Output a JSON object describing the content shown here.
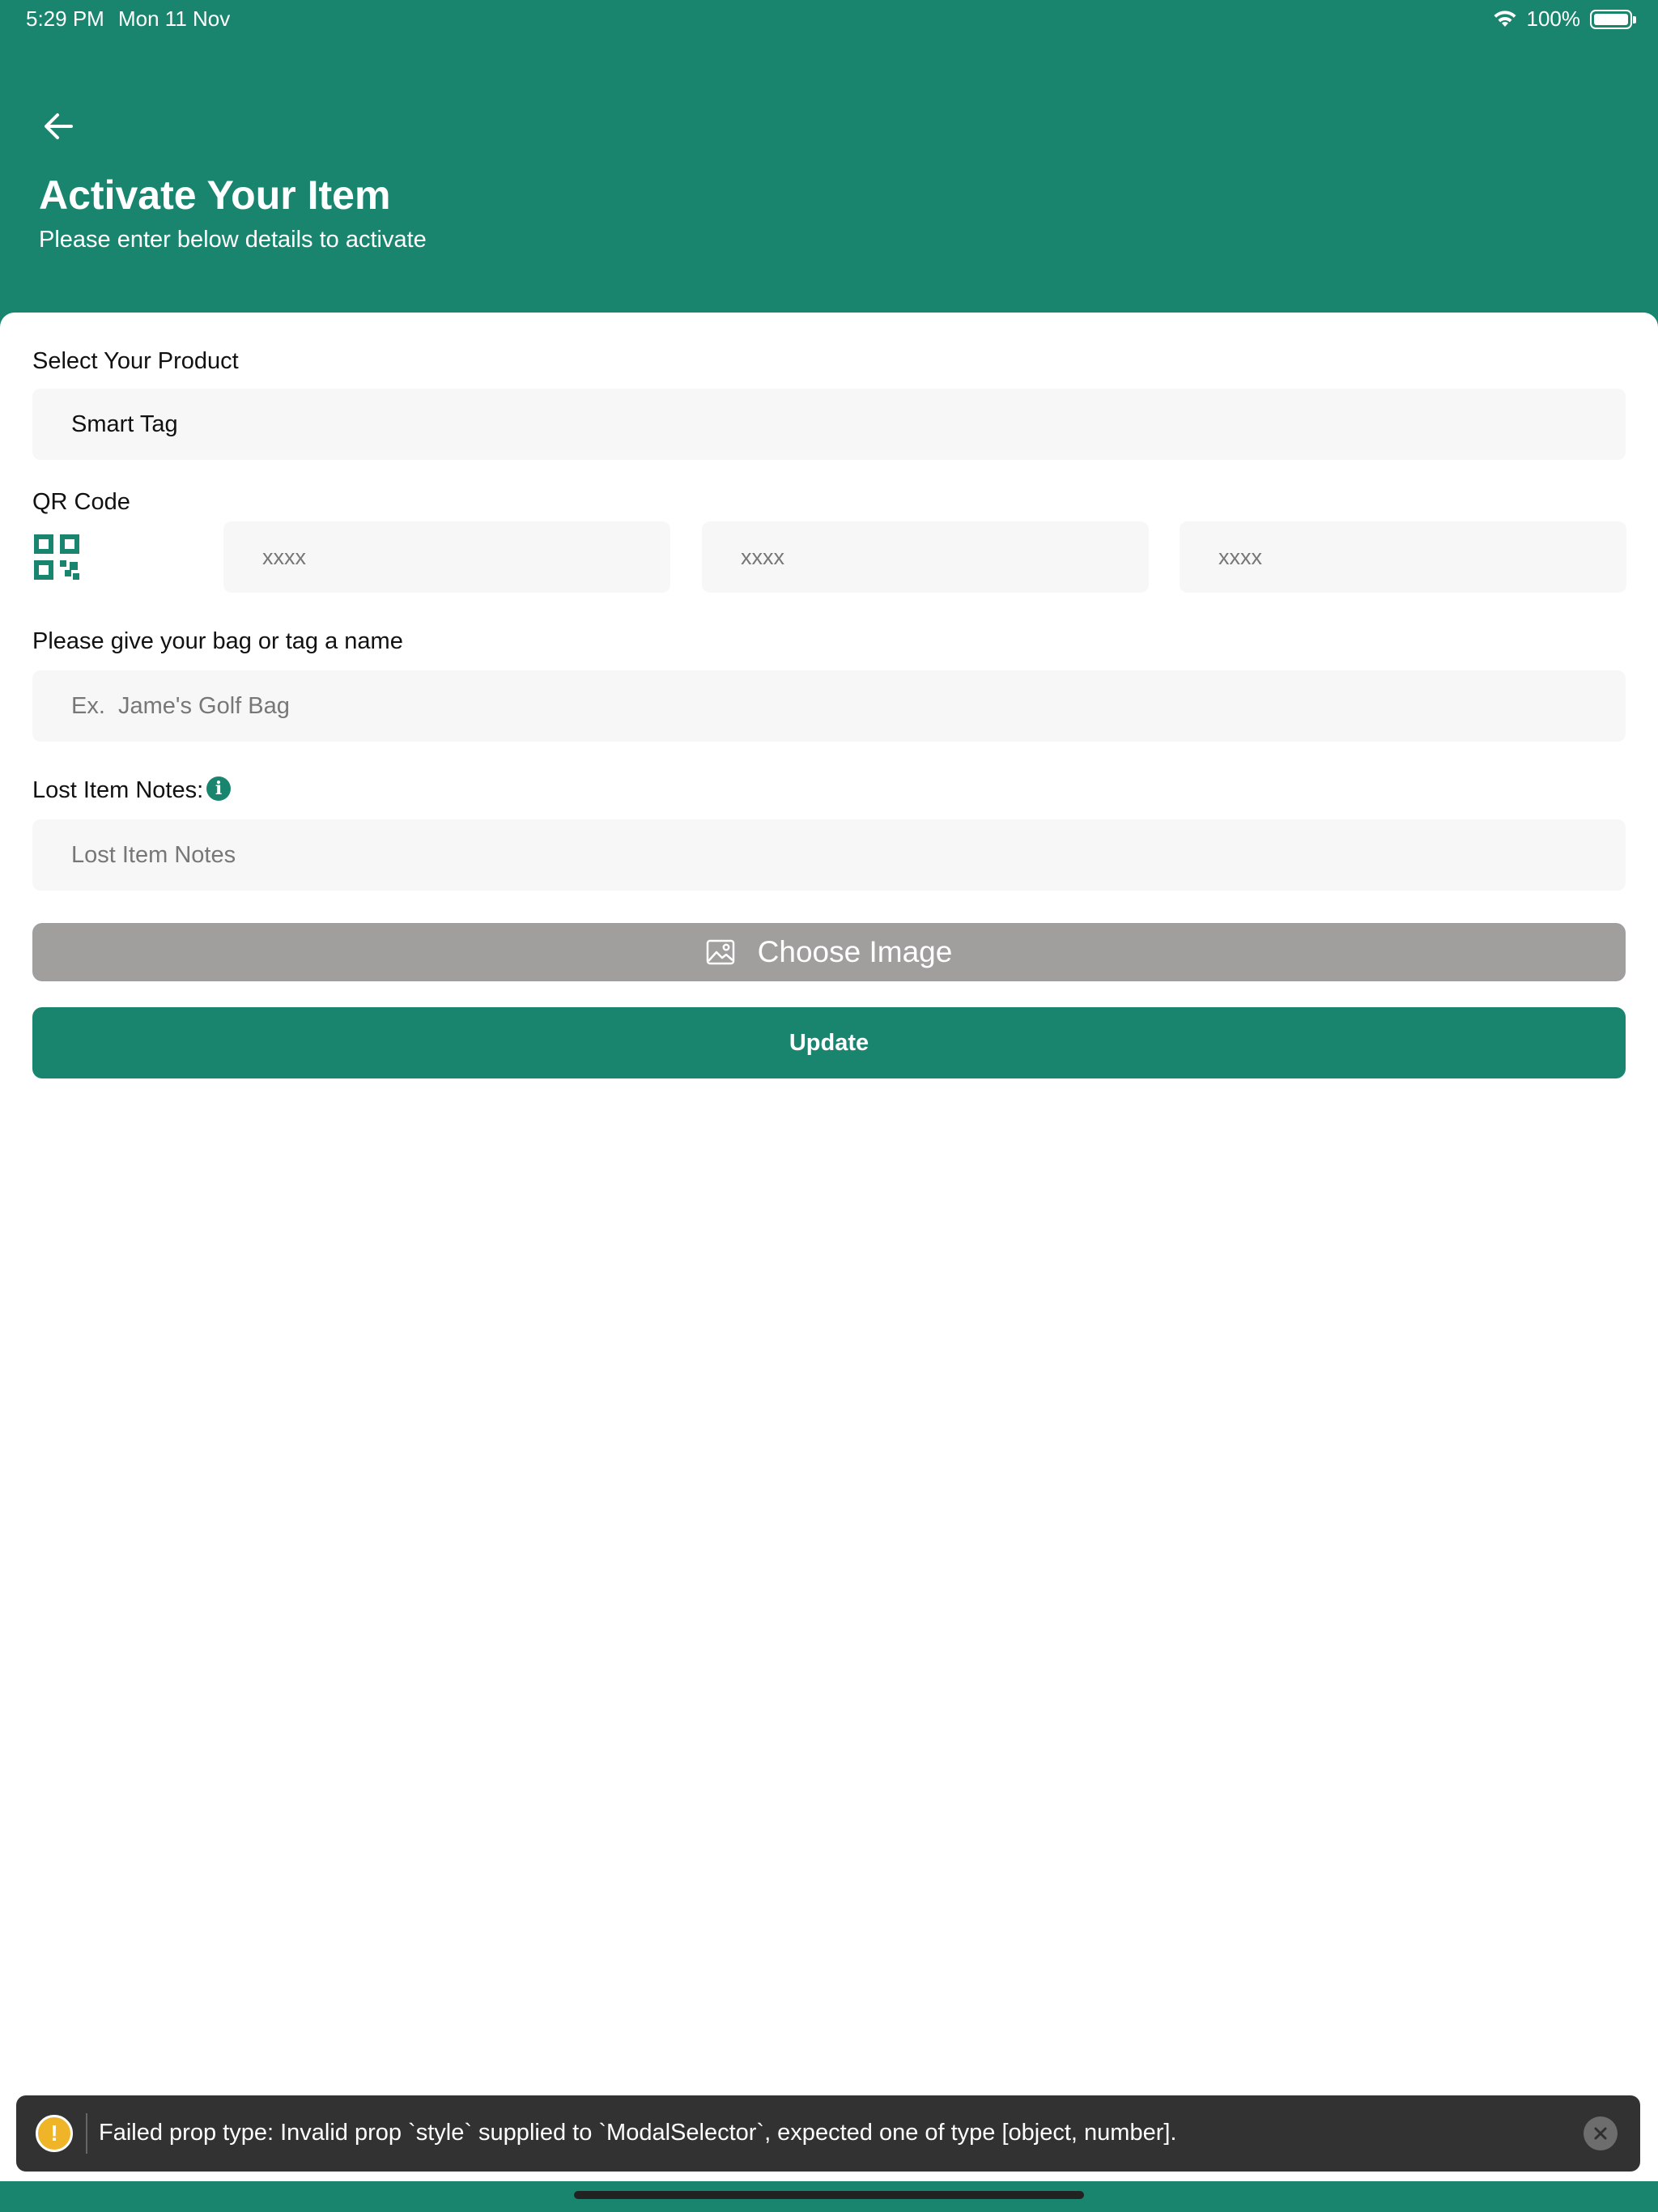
{
  "status_bar": {
    "time": "5:29 PM",
    "date": "Mon 11 Nov",
    "battery_text": "100%",
    "battery_level": 1.0,
    "icons": [
      "wifi-icon",
      "battery-icon"
    ]
  },
  "header": {
    "back_icon": "arrow-left-icon",
    "title": "Activate Your Item",
    "subtitle": "Please enter below details to activate"
  },
  "form": {
    "product": {
      "label": "Select Your Product",
      "value": "Smart Tag"
    },
    "qr": {
      "label": "QR Code",
      "icon": "qr-code-icon",
      "segments": [
        {
          "value": "",
          "placeholder": "xxxx"
        },
        {
          "value": "",
          "placeholder": "xxxx"
        },
        {
          "value": "",
          "placeholder": "xxxx"
        }
      ]
    },
    "name": {
      "label": "Please give your bag or tag a name",
      "value": "",
      "placeholder": "Ex.  Jame's Golf Bag"
    },
    "notes": {
      "label": "Lost Item Notes:",
      "info_icon": "info-icon",
      "value": "",
      "placeholder": "Lost Item Notes"
    },
    "choose_image_label": "Choose Image",
    "choose_image_icon": "image-icon",
    "update_label": "Update"
  },
  "toast": {
    "icon": "warning-icon",
    "message": "Failed prop type: Invalid prop `style` supplied to `ModalSelector`, expected one of type [object, number].",
    "close_icon": "close-icon"
  },
  "colors": {
    "brand": "#1a856e",
    "field_bg": "#f7f7f7",
    "disabled_button": "#a09f9d",
    "toast_bg": "#323232",
    "warning": "#f0b429"
  }
}
